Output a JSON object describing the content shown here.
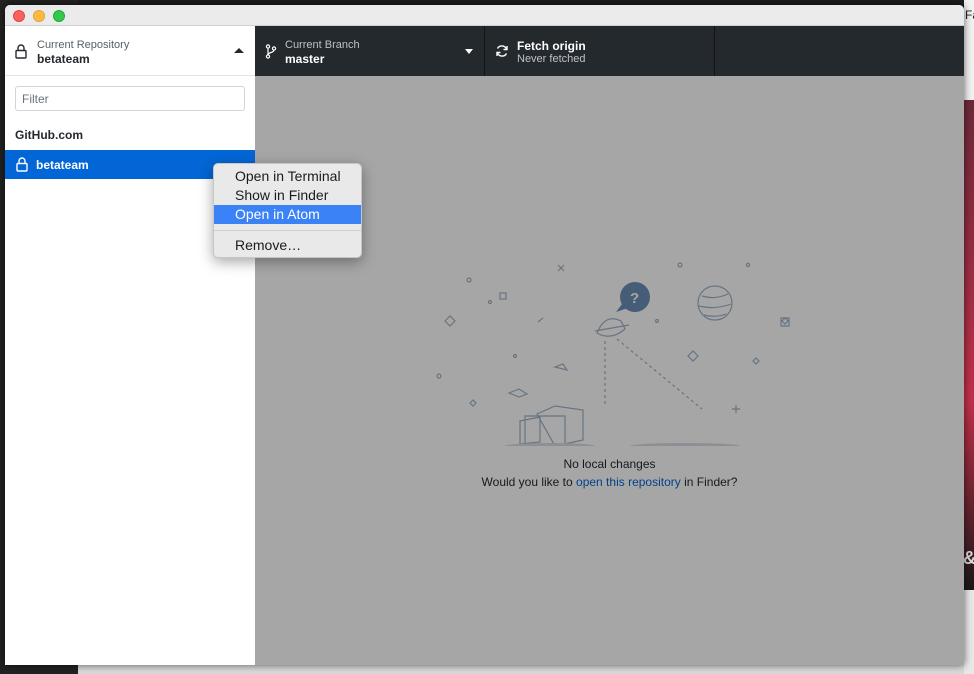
{
  "desktop": {
    "right_text": "Fa",
    "right_amp": "&"
  },
  "sidebar": {
    "repo_caption": "Current Repository",
    "repo_name": "betateam",
    "filter_placeholder": "Filter",
    "group_header": "GitHub.com",
    "repositories": [
      {
        "name": "betateam",
        "selected": true
      }
    ]
  },
  "toolbar": {
    "branch_caption": "Current Branch",
    "branch_value": "master",
    "fetch_title": "Fetch origin",
    "fetch_subtitle": "Never fetched"
  },
  "main": {
    "blank_title": "No local changes",
    "blank_desc_prefix": "Would you like to ",
    "blank_link": "open this repository",
    "blank_desc_suffix": " in Finder?"
  },
  "context_menu": {
    "items": [
      {
        "label": "Open in Terminal"
      },
      {
        "label": "Show in Finder"
      },
      {
        "label": "Open in Atom",
        "highlighted": true
      },
      {
        "label": "Remove…"
      }
    ]
  },
  "colors": {
    "accent": "#0366d6",
    "toolbar_bg": "#24292e",
    "menu_highlight": "#3b82f6"
  }
}
